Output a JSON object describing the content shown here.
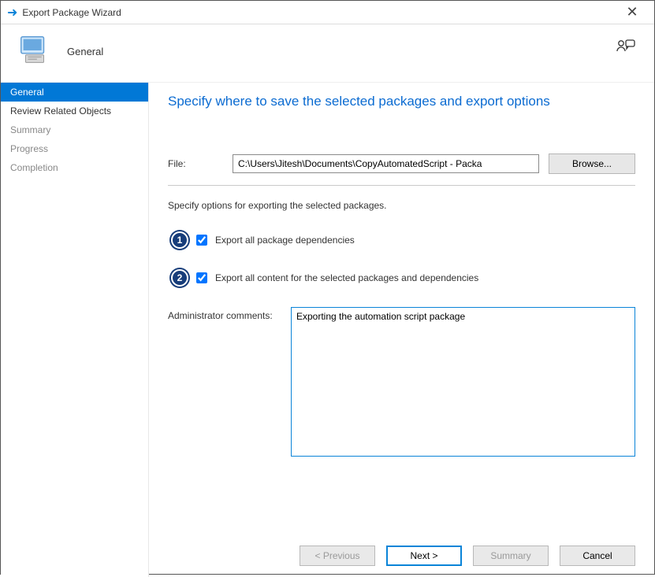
{
  "titlebar": {
    "title": "Export Package Wizard"
  },
  "header": {
    "section": "General"
  },
  "sidebar": {
    "items": [
      {
        "label": "General",
        "active": true,
        "dim": false
      },
      {
        "label": "Review Related Objects",
        "active": false,
        "dim": false
      },
      {
        "label": "Summary",
        "active": false,
        "dim": true
      },
      {
        "label": "Progress",
        "active": false,
        "dim": true
      },
      {
        "label": "Completion",
        "active": false,
        "dim": true
      }
    ]
  },
  "main": {
    "heading": "Specify where to save the selected packages and export options",
    "file_label": "File:",
    "file_value": "C:\\Users\\Jitesh\\Documents\\CopyAutomatedScript - Packa",
    "browse_label": "Browse...",
    "instruction": "Specify options for exporting the selected packages.",
    "badge1": "1",
    "check1_label": "Export all package dependencies",
    "badge2": "2",
    "check2_label": "Export all content for the selected packages and dependencies",
    "comments_label": "Administrator comments:",
    "comments_value": "Exporting the automation script package"
  },
  "footer": {
    "previous": "< Previous",
    "next": "Next >",
    "summary": "Summary",
    "cancel": "Cancel"
  }
}
